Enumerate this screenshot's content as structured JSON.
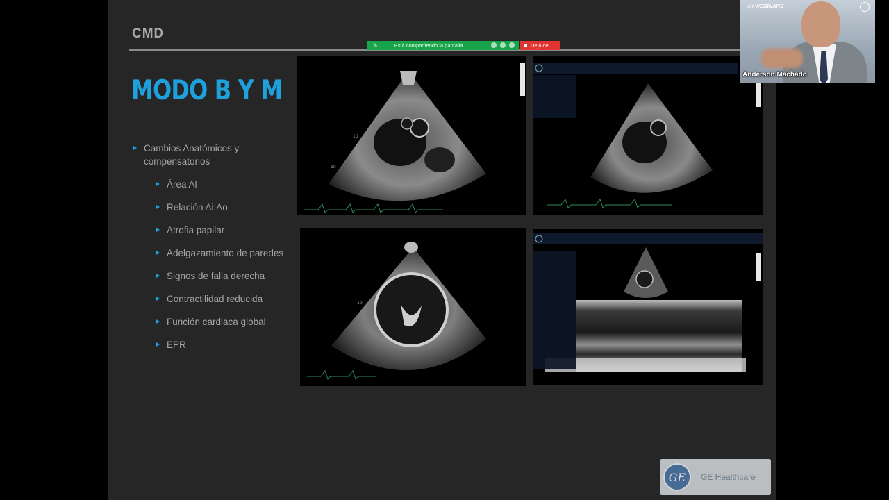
{
  "slide": {
    "header": "CMD",
    "title": "MODO B Y M",
    "bullet_main": "Cambios Anatómicos y compensatorios",
    "sub_bullets": [
      "Área Al",
      "Relación Ai:Ao",
      "Atrofia papilar",
      "Adelgazamiento de paredes",
      "Signos de falla derecha",
      "Contractilidad reducida",
      "Función cardiaca global",
      "EPR"
    ]
  },
  "screen_share": {
    "status_text": "Está compartiendo la pantalla",
    "stop_label": "Deja de"
  },
  "webcam": {
    "brand_prefix": "Vet",
    "brand_suffix": "WEBINARS",
    "presenter_name": "Anderson Machado"
  },
  "logo": {
    "company": "GE Healthcare",
    "mark": "GE"
  },
  "colors": {
    "accent": "#1ea0dc",
    "slide_bg": "#262627",
    "share_green": "#19a34a",
    "stop_red": "#e1332f"
  }
}
